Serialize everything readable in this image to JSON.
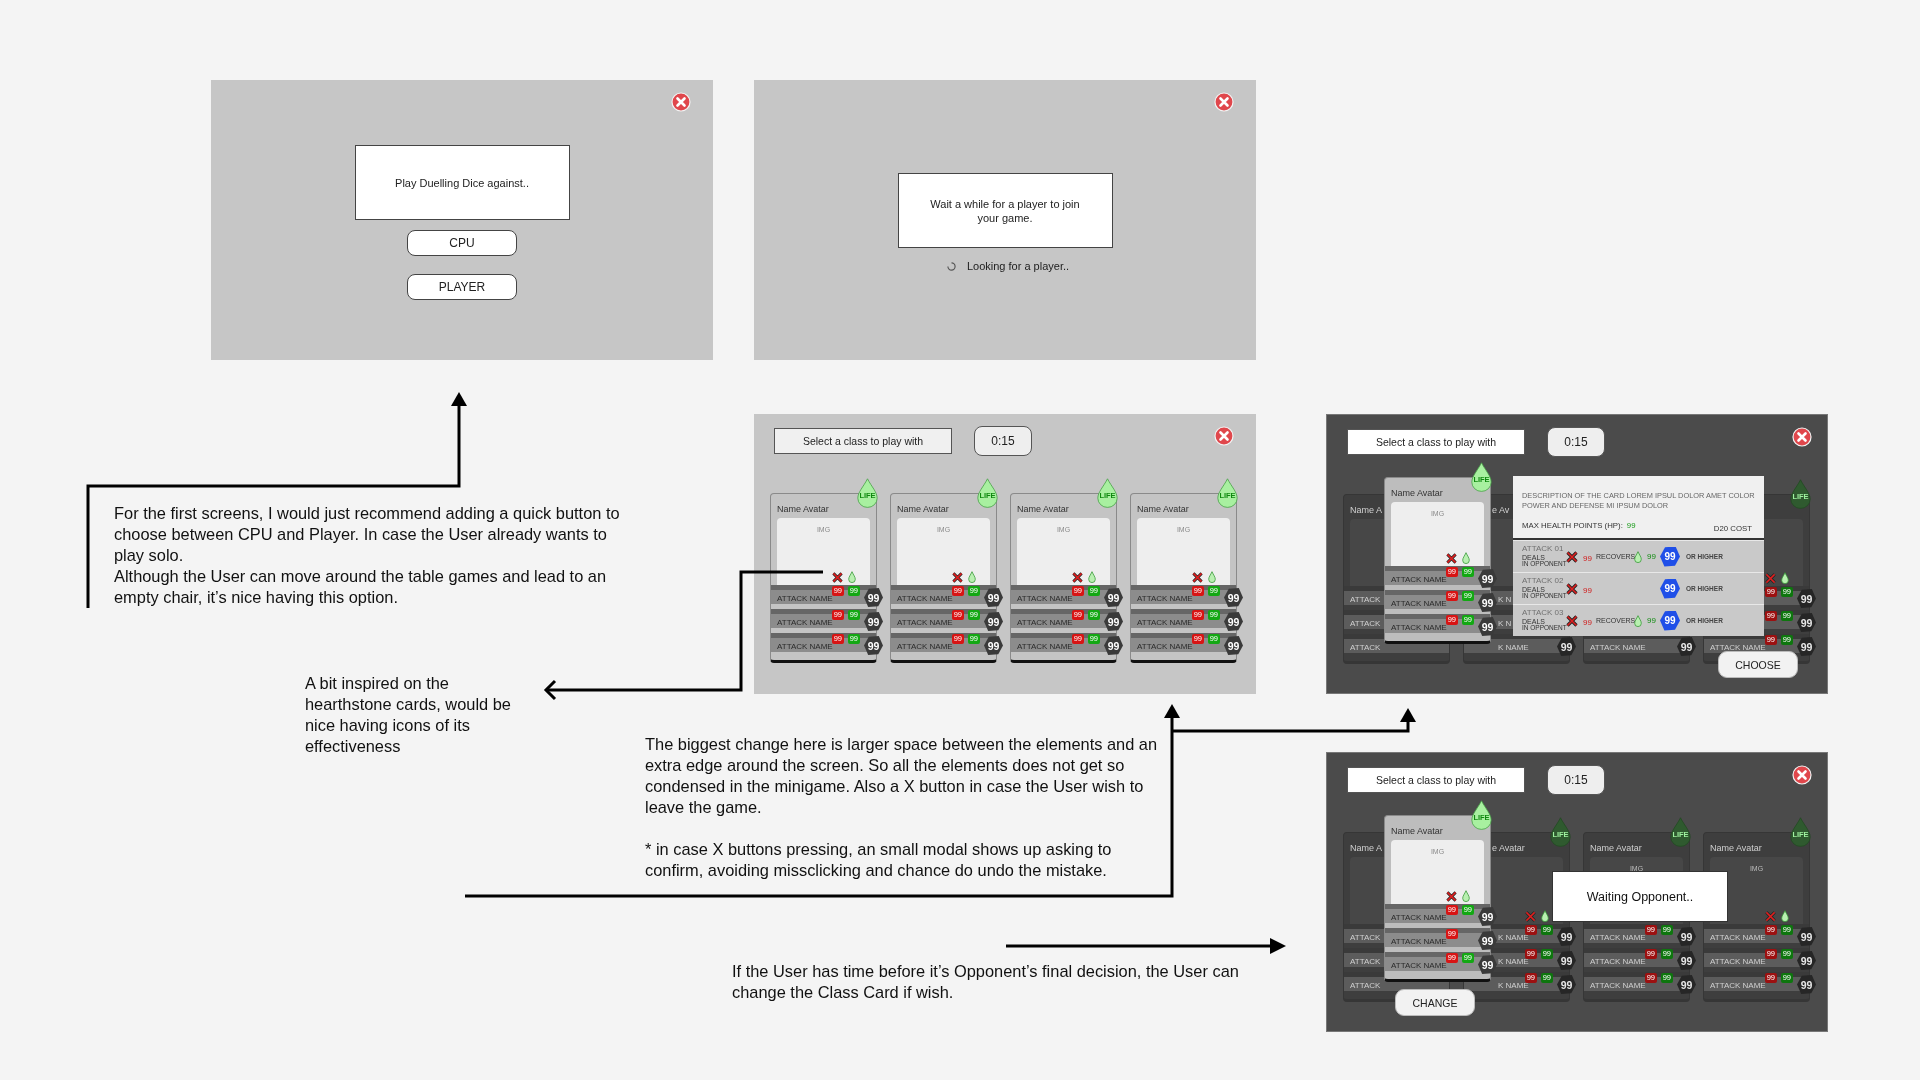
{
  "screens": [
    {
      "kind": "choice",
      "prompt": "Play Duelling Dice against..",
      "options": [
        "CPU",
        "PLAYER"
      ]
    },
    {
      "kind": "waiting",
      "message": "Wait a while for a player to join your game.",
      "status": "Looking for a player.."
    },
    {
      "kind": "class-select",
      "dimmed": false,
      "title": "Select a class to play with",
      "timer": "0:15",
      "cards": [
        {
          "name": "Name Avatar",
          "life": "LIFE",
          "img": "IMG",
          "effect_icons": true,
          "attacks": [
            {
              "name": "ATTACK NAME",
              "deals": "99",
              "recovers": "99",
              "dice": "99"
            },
            {
              "name": "ATTACK NAME",
              "deals": "99",
              "recovers": "99",
              "dice": "99"
            },
            {
              "name": "ATTACK NAME",
              "deals": "99",
              "recovers": "99",
              "dice": "99"
            }
          ]
        },
        {
          "name": "Name Avatar",
          "life": "LIFE",
          "img": "IMG",
          "effect_icons": true,
          "attacks": [
            {
              "name": "ATTACK NAME",
              "deals": "99",
              "recovers": "99",
              "dice": "99"
            },
            {
              "name": "ATTACK NAME",
              "deals": "99",
              "recovers": "99",
              "dice": "99"
            },
            {
              "name": "ATTACK NAME",
              "deals": "99",
              "recovers": "99",
              "dice": "99"
            }
          ]
        },
        {
          "name": "Name Avatar",
          "life": "LIFE",
          "img": "IMG",
          "effect_icons": true,
          "attacks": [
            {
              "name": "ATTACK NAME",
              "deals": "99",
              "recovers": "99",
              "dice": "99"
            },
            {
              "name": "ATTACK NAME",
              "deals": "99",
              "recovers": "99",
              "dice": "99"
            },
            {
              "name": "ATTACK NAME",
              "deals": "99",
              "recovers": "99",
              "dice": "99"
            }
          ]
        },
        {
          "name": "Name Avatar",
          "life": "LIFE",
          "img": "IMG",
          "effect_icons": true,
          "attacks": [
            {
              "name": "ATTACK NAME",
              "deals": "99",
              "recovers": "99",
              "dice": "99"
            },
            {
              "name": "ATTACK NAME",
              "deals": "99",
              "recovers": "99",
              "dice": "99"
            },
            {
              "name": "ATTACK NAME",
              "deals": "99",
              "recovers": "99",
              "dice": "99"
            }
          ]
        }
      ]
    },
    {
      "kind": "class-select",
      "dimmed": true,
      "title": "Select a class to play with",
      "timer": "0:15",
      "cards": [
        {
          "name": "Name A",
          "attacks": [
            {
              "name": "ATTACK"
            },
            {
              "name": "ATTACK"
            },
            {
              "name": "ATTACK"
            }
          ]
        },
        {
          "name": "e Av",
          "attacks": [
            {
              "name": "K N"
            },
            {
              "name": "K N"
            },
            {
              "name": "K NAME",
              "dice": "99"
            }
          ]
        },
        {
          "attacks": [
            {
              "name": "ATTACK NAME",
              "dice": "99"
            }
          ]
        },
        {
          "life": "LIFE",
          "effect_icons": true,
          "attacks": [
            {
              "deals": "99",
              "recovers": "99",
              "dice": "99"
            },
            {
              "deals": "99",
              "recovers": "99",
              "dice": "99"
            },
            {
              "name": "ATTACK NAME",
              "deals": "99",
              "recovers": "99",
              "dice": "99"
            }
          ]
        }
      ],
      "raised_card": {
        "name": "Name Avatar",
        "life": "LIFE",
        "img": "IMG",
        "effect_icons": true,
        "attacks": [
          {
            "name": "ATTACK NAME",
            "deals": "99",
            "recovers": "99",
            "dice": "99"
          },
          {
            "name": "ATTACK NAME",
            "deals": "99",
            "recovers": "99",
            "dice": "99"
          },
          {
            "name": "ATTACK NAME",
            "deals": "99",
            "recovers": "99",
            "dice": "99"
          }
        ]
      },
      "detail": {
        "description": "DESCRIPTION OF THE CARD LOREM IPSUL DOLOR AMET COLOR POWER AND DEFENSE MI IPSUM DOLOR",
        "hp_label": "MAX HEALTH POINTS (HP):",
        "hp": "99",
        "cost_label": "D20 COST",
        "attacks": [
          {
            "title": "ATTACK 01",
            "deals_label": "DEALS",
            "deals_note": "IN OPPONENT",
            "deals": "99",
            "recovers_label": "RECOVERS",
            "recovers": "99",
            "roll": "99",
            "roll_note": "OR HIGHER"
          },
          {
            "title": "ATTACK 02",
            "deals_label": "DEALS",
            "deals_note": "IN OPPONENT",
            "deals": "99",
            "roll": "99",
            "roll_note": "OR HIGHER"
          },
          {
            "title": "ATTACK 03",
            "deals_label": "DEALS",
            "deals_note": "IN OPPONENT",
            "deals": "99",
            "recovers_label": "RECOVERS",
            "recovers": "99",
            "roll": "99",
            "roll_note": "OR HIGHER"
          }
        ]
      },
      "action": {
        "kind": "choose",
        "label": "CHOOSE"
      }
    },
    {
      "kind": "class-select",
      "dimmed": true,
      "title": "Select a class to play with",
      "timer": "0:15",
      "cards": [
        {
          "name": "Name A",
          "attacks": [
            {
              "name": "ATTACK"
            },
            {
              "name": "ATTACK"
            },
            {
              "name": "ATTACK"
            }
          ]
        },
        {
          "name": "e Avatar",
          "life": "LIFE",
          "effect_icons": true,
          "attacks": [
            {
              "name": "K NAME",
              "deals": "99",
              "recovers": "99",
              "dice": "99"
            },
            {
              "name": "K NAME",
              "deals": "99",
              "recovers": "99",
              "dice": "99"
            },
            {
              "name": "K NAME",
              "deals": "99",
              "recovers": "99",
              "dice": "99"
            }
          ]
        },
        {
          "name": "Name Avatar",
          "life": "LIFE",
          "img": "IMG",
          "attacks": [
            {
              "name": "ATTACK NAME",
              "deals": "99",
              "recovers": "99",
              "dice": "99"
            },
            {
              "name": "ATTACK NAME",
              "deals": "99",
              "recovers": "99",
              "dice": "99"
            },
            {
              "name": "ATTACK NAME",
              "deals": "99",
              "recovers": "99",
              "dice": "99"
            }
          ]
        },
        {
          "name": "Name Avatar",
          "life": "LIFE",
          "img": "IMG",
          "effect_icons": true,
          "attacks": [
            {
              "name": "ATTACK NAME",
              "deals": "99",
              "recovers": "99",
              "dice": "99"
            },
            {
              "name": "ATTACK NAME",
              "deals": "99",
              "recovers": "99",
              "dice": "99"
            },
            {
              "name": "ATTACK NAME",
              "deals": "99",
              "recovers": "99",
              "dice": "99"
            }
          ]
        }
      ],
      "raised_card": {
        "name": "Name Avatar",
        "life": "LIFE",
        "img": "IMG",
        "effect_icons": true,
        "attacks": [
          {
            "name": "ATTACK NAME",
            "deals": "99",
            "recovers": "99",
            "dice": "99"
          },
          {
            "name": "ATTACK NAME",
            "deals": "99",
            "dice": "99"
          },
          {
            "name": "ATTACK NAME",
            "deals": "99",
            "recovers": "99",
            "dice": "99"
          }
        ]
      },
      "message": "Waiting Opponent..",
      "action": {
        "kind": "change",
        "label": "CHANGE"
      }
    }
  ],
  "notes": [
    {
      "paragraphs": [
        "For the first screens, I would just recommend adding a quick button to choose between CPU and Player. In case the User already wants to play solo.",
        "Although the User can move around the table games and lead to an empty chair, it’s nice having this option."
      ]
    },
    {
      "paragraphs": [
        "A bit inspired on the hearthstone cards, would be nice having icons of its effectiveness"
      ]
    },
    {
      "paragraphs": [
        "The biggest change here is larger space between the elements and an extra edge around the screen. So all the elements does not get so condensed in the minigame. Also a X button in case the User wish to leave the game.",
        "* in case X buttons pressing, an small modal shows up asking to confirm, avoiding missclicking and chance do undo the mistake."
      ]
    },
    {
      "paragraphs": [
        "If the User has time before it’s Opponent’s final decision, the User can change the Class Card if wish."
      ]
    }
  ]
}
